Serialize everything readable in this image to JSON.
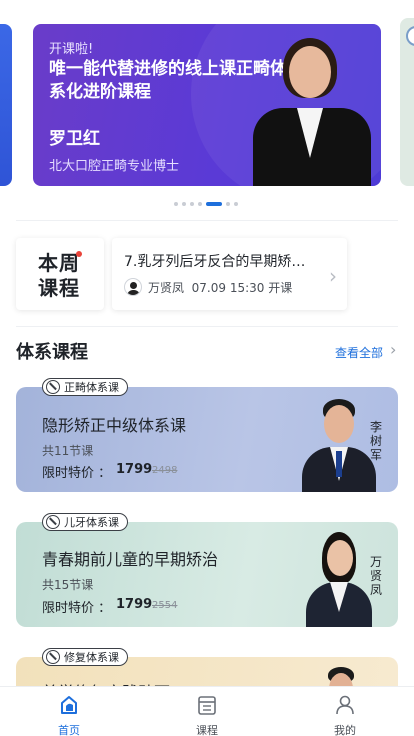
{
  "banner": {
    "kicker": "开课啦!",
    "title": "唯一能代替进修的线上课正畸体系化进阶课程",
    "name": "罗卫红",
    "subtitle": "北大口腔正畸专业博士",
    "dots_total": 7,
    "active_dot": 4
  },
  "this_week": {
    "label": "本周课程",
    "course_title": "7.乳牙列后牙反合的早期矫…",
    "teacher": "万贤凤",
    "time": "07.09 15:30 开课"
  },
  "section": {
    "title": "体系课程",
    "more": "查看全部"
  },
  "courses": [
    {
      "tag": "正畸体系课",
      "title": "隐形矫正中级体系课",
      "count": "共11节课",
      "price_label": "限时特价 ：",
      "price": "1799",
      "original": "2498",
      "teacher": "李树军",
      "bg": "#a6b6dc"
    },
    {
      "tag": "儿牙体系课",
      "title": "青春期前儿童的早期矫治",
      "count": "共15节课",
      "price_label": "限时特价 ：",
      "price": "1799",
      "original": "2554",
      "teacher": "万贤凤",
      "bg": "#c4dfd8"
    },
    {
      "tag": "修复体系课",
      "title": "美学修复实践贴面",
      "bg": "#f3e3bf"
    }
  ],
  "tabs": [
    {
      "label": "首页",
      "active": true
    },
    {
      "label": "课程",
      "active": false
    },
    {
      "label": "我的",
      "active": false
    }
  ],
  "colors": {
    "accent": "#1e6fdc",
    "banner": "#5a3ad6"
  }
}
